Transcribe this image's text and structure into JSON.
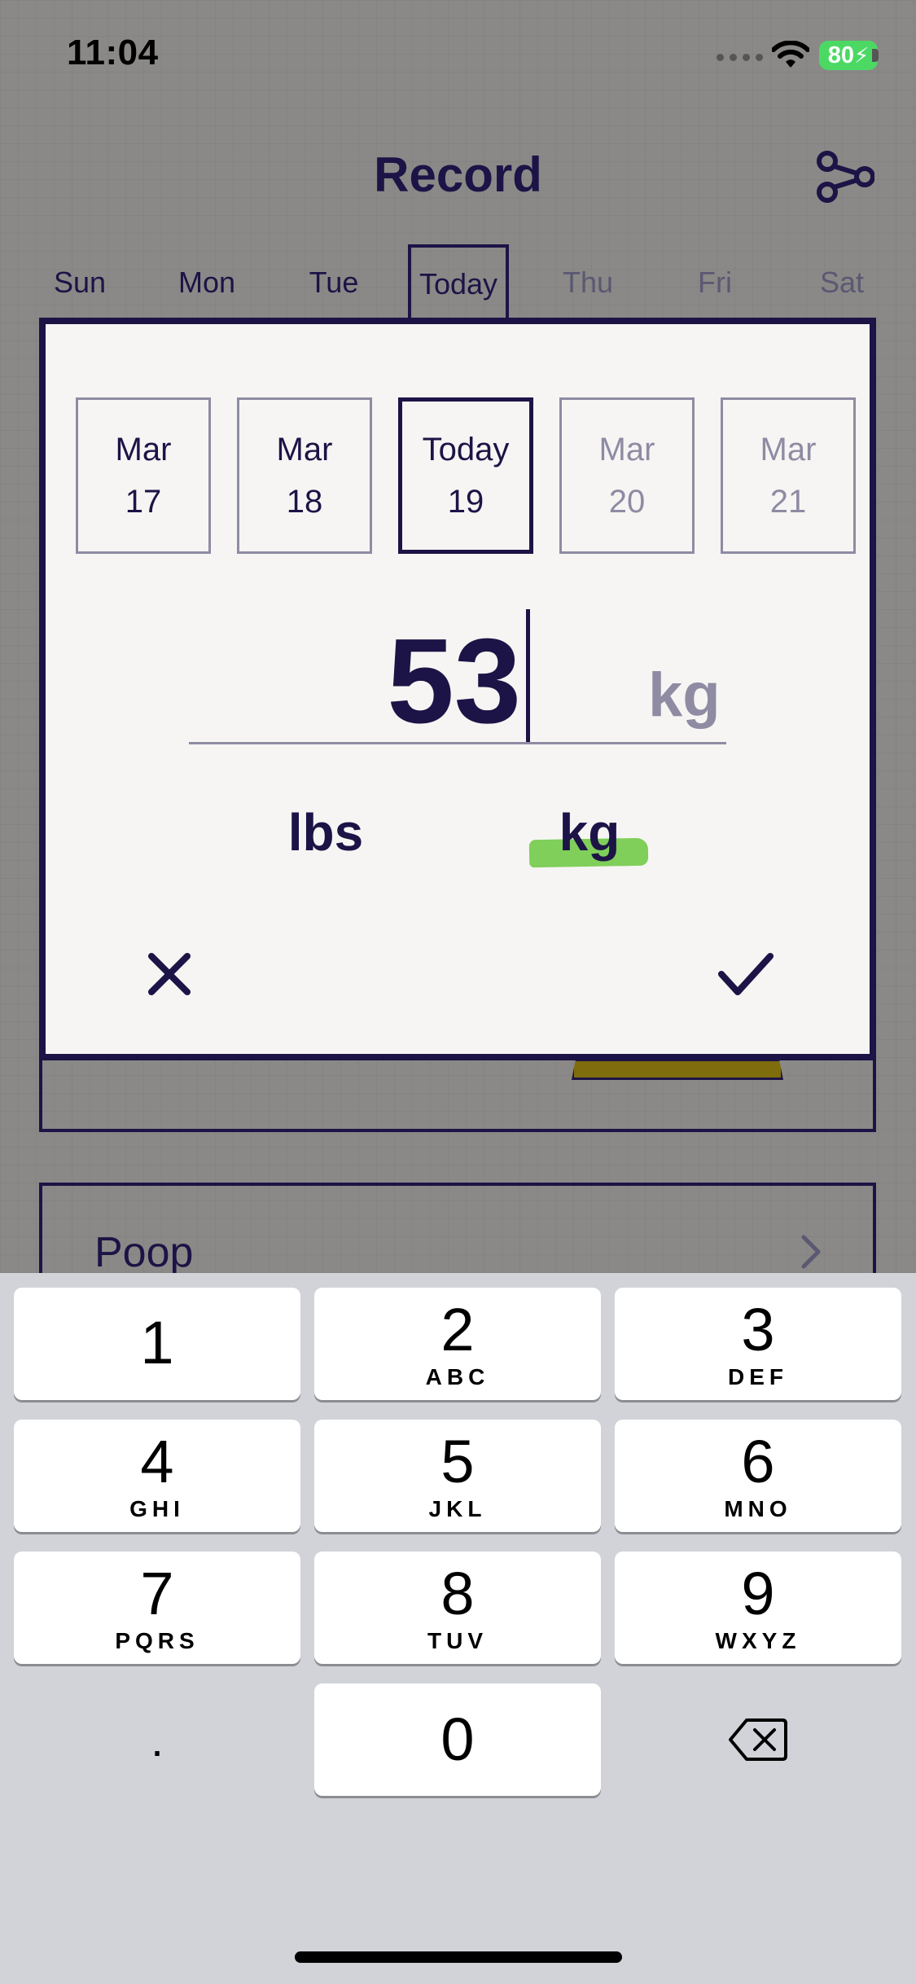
{
  "status_bar": {
    "time": "11:04",
    "battery": "80"
  },
  "header": {
    "title": "Record",
    "share_icon": "share-icon"
  },
  "week": [
    {
      "label": "Sun",
      "state": "past"
    },
    {
      "label": "Mon",
      "state": "past"
    },
    {
      "label": "Tue",
      "state": "past"
    },
    {
      "label": "Today",
      "state": "today"
    },
    {
      "label": "Thu",
      "state": "future"
    },
    {
      "label": "Fri",
      "state": "future"
    },
    {
      "label": "Sat",
      "state": "future"
    }
  ],
  "background": {
    "poop_label": "Poop"
  },
  "modal": {
    "dates": [
      {
        "line1": "Mar",
        "line2": "17",
        "state": "past"
      },
      {
        "line1": "Mar",
        "line2": "18",
        "state": "past"
      },
      {
        "line1": "Today",
        "line2": "19",
        "state": "selected"
      },
      {
        "line1": "Mar",
        "line2": "20",
        "state": "future"
      },
      {
        "line1": "Mar",
        "line2": "21",
        "state": "future"
      }
    ],
    "value": "53",
    "unit_suffix": "kg",
    "units": {
      "lbs": "lbs",
      "kg": "kg",
      "selected": "kg"
    },
    "cancel_icon": "close-icon",
    "confirm_icon": "check-icon"
  },
  "keyboard": {
    "keys": [
      {
        "num": "1",
        "letters": ""
      },
      {
        "num": "2",
        "letters": "ABC"
      },
      {
        "num": "3",
        "letters": "DEF"
      },
      {
        "num": "4",
        "letters": "GHI"
      },
      {
        "num": "5",
        "letters": "JKL"
      },
      {
        "num": "6",
        "letters": "MNO"
      },
      {
        "num": "7",
        "letters": "PQRS"
      },
      {
        "num": "8",
        "letters": "TUV"
      },
      {
        "num": "9",
        "letters": "WXYZ"
      }
    ],
    "decimal": ".",
    "zero": "0",
    "backspace_icon": "backspace-icon"
  },
  "colors": {
    "ink": "#1c1446",
    "muted": "#8e8ba3",
    "highlight": "#7fcf5a",
    "battery": "#4bd964"
  }
}
